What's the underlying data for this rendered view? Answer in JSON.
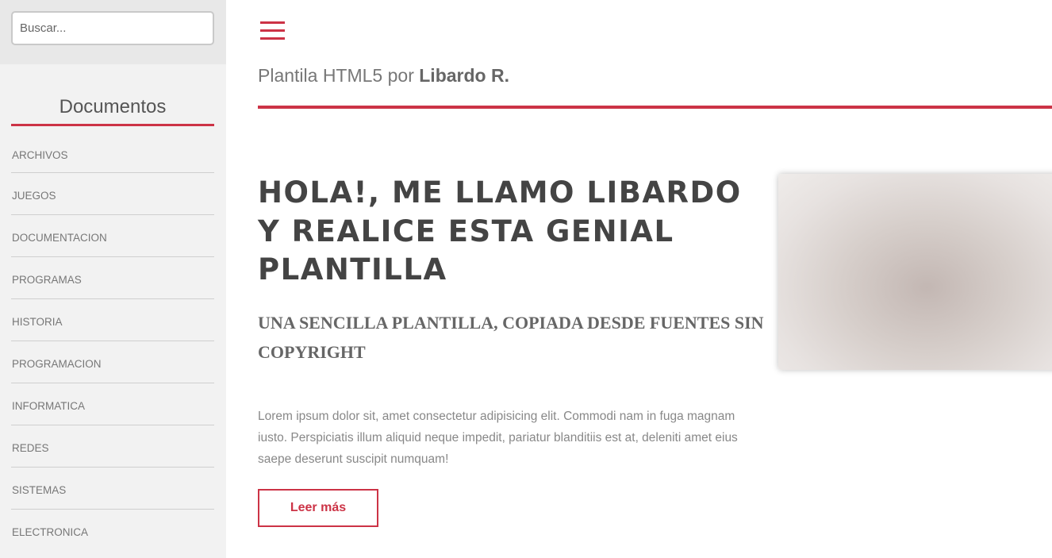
{
  "sidebar": {
    "search": {
      "placeholder": "Buscar..."
    },
    "title": "Documentos",
    "items": [
      "ARCHIVOS",
      "JUEGOS",
      "DOCUMENTACION",
      "PROGRAMAS",
      "HISTORIA",
      "PROGRAMACION",
      "INFORMATICA",
      "REDES",
      "SISTEMAS",
      "ELECTRONICA"
    ]
  },
  "header": {
    "title_prefix": "Plantila HTML5 por ",
    "title_author": "Libardo R."
  },
  "hero": {
    "title": "HOLA!, ME LLAMO LIBARDO Y REALICE ESTA GENIAL PLANTILLA",
    "subtitle": "UNA SENCILLA PLANTILLA, COPIADA DESDE FUENTES SIN COPYRIGHT",
    "text": "Lorem ipsum dolor sit, amet consectetur adipisicing elit. Commodi nam in fuga magnam iusto. Perspiciatis illum aliquid neque impedit, pariatur blanditiis est at, deleniti amet eius saepe deserunt suscipit numquam!",
    "button_label": "Leer más"
  },
  "colors": {
    "accent": "#cc3346",
    "sidebar_bg": "#f2f2f2",
    "text_dark": "#444444"
  },
  "icons": {
    "menu": "hamburger-menu-icon"
  }
}
